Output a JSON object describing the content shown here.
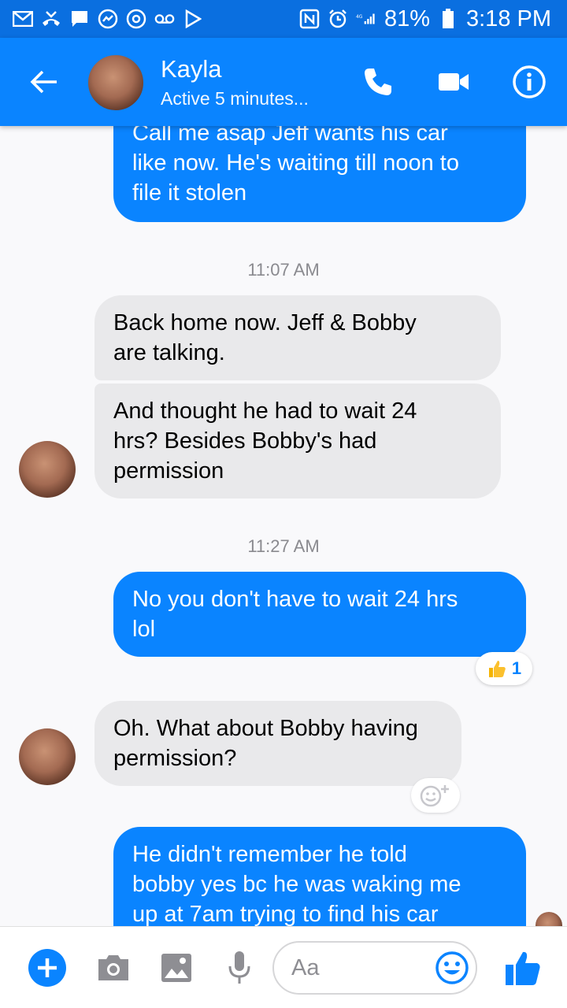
{
  "status_bar": {
    "battery": "81%",
    "time": "3:18 PM"
  },
  "header": {
    "contact_name": "Kayla",
    "contact_status": "Active 5 minutes..."
  },
  "messages": [
    {
      "direction": "outgoing",
      "text_lines": [
        "Call me asap Jeff wants his car",
        "like now. He's waiting till noon to",
        "file it stolen"
      ]
    },
    {
      "type": "timestamp",
      "text": "11:07 AM"
    },
    {
      "direction": "incoming",
      "text_lines": [
        "Back home now. Jeff & Bobby",
        "are talking."
      ]
    },
    {
      "direction": "incoming",
      "text_lines": [
        "And thought he had to wait 24",
        "hrs? Besides Bobby's had",
        "permission"
      ]
    },
    {
      "type": "timestamp",
      "text": "11:27 AM"
    },
    {
      "direction": "outgoing",
      "text_lines": [
        "No you don't have to wait 24 hrs",
        "lol"
      ],
      "reaction": {
        "icon": "thumbs-up-emoji",
        "count": "1"
      }
    },
    {
      "direction": "incoming",
      "text_lines": [
        "Oh. What about Bobby having",
        "permission?"
      ]
    },
    {
      "direction": "outgoing",
      "text_lines": [
        "He didn't remember he told",
        "bobby yes bc he was waking me",
        "up at 7am trying to find his car"
      ]
    }
  ],
  "composer": {
    "placeholder": "Aa"
  },
  "colors": {
    "status_bar": "#0a6fe0",
    "header": "#0a84ff",
    "outgoing_bubble": "#0a84ff",
    "incoming_bubble": "#e9e9eb",
    "background": "#f9f9fb"
  }
}
